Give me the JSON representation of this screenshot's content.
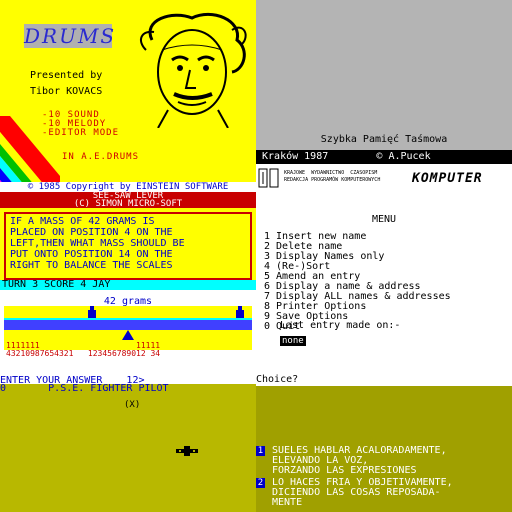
{
  "drums": {
    "logo": "DRUMS",
    "presented_by": "Presented by",
    "author": "Tibor KOVACS",
    "options": [
      "-10 SOUND",
      "-10 MELODY",
      "-EDITOR MODE"
    ],
    "tagline": "IN  A.E.DRUMS"
  },
  "copyright": {
    "line1": "© 1985 Copyright by EINSTEIN SOFTWARE",
    "line2a": "SEE-SAW LEVER",
    "line2b": "(C)  SIMON MICRO-SOFT"
  },
  "seesaw": {
    "question": "IF A MASS OF 42 GRAMS IS\nPLACED ON POSITION 4 ON THE\nLEFT,THEN WHAT MASS SHOULD BE\nPUT ONTO POSITION 14 ON THE\nRIGHT TO BALANCE THE SCALES",
    "status": "TURN 3 SCORE 4   JAY",
    "grams": "42 grams",
    "digits_top": "1111111                    11111",
    "digits_bottom": "43210987654321   123456789012 34",
    "answer_prompt": "ENTER YOUR ANSWER    12>"
  },
  "komputer": {
    "title": "Szybka Pamięć Taśmowa",
    "krakow": " Kraków 1987        © A.Pucek",
    "publisher": "KRAJOWE  WYDAWNICTWO  CZASOPISM\nREDAKCJA PROGRAMÓW KOMPUTEROWYCH",
    "logo": "KOMPUTER",
    "menu_title": "MENU",
    "menu_items": "1 Insert new name\n2 Delete name\n3 Display Names only\n4 (Re-)Sort\n5 Amend an entry\n6 Display a name & address\n7 Display ALL names & addresses\n8 Printer Options\n9 Save Options\n0 Quit",
    "last_entry": "Last entry made on:-",
    "none": "none",
    "choice": "Choice?"
  },
  "pilot": {
    "title": "0       P.S.E. FIGHTER PILOT",
    "marker": "(X)"
  },
  "spanish": {
    "answer1": "SUELES HABLAR ACALORADAMENTE,\nELEVANDO LA VOZ,\nFORZANDO LAS EXPRESIONES",
    "answer2": "LO HACES FRIA Y OBJETIVAMENTE,\nDICIENDO LAS COSAS REPOSADA-\nMENTE",
    "num1": "1",
    "num2": "2"
  },
  "colors": {
    "spectrum_yellow": "#ffff00",
    "spectrum_red": "#c80000",
    "spectrum_blue": "#0000c8",
    "spectrum_cyan": "#00ffff"
  }
}
